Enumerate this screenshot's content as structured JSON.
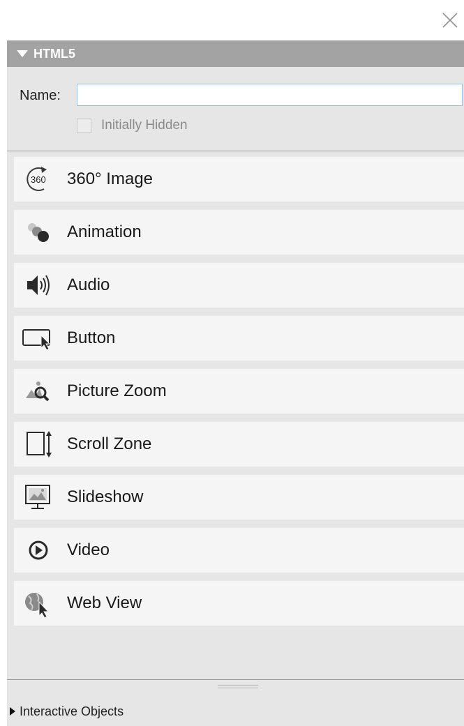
{
  "window": {
    "close_icon": "close-icon"
  },
  "section": {
    "title": "HTML5",
    "name_label": "Name:",
    "name_value": "",
    "initially_hidden_label": "Initially Hidden",
    "initially_hidden_checked": false
  },
  "items": [
    {
      "label": "360° Image",
      "icon": "360-image-icon"
    },
    {
      "label": "Animation",
      "icon": "animation-icon"
    },
    {
      "label": "Audio",
      "icon": "audio-icon"
    },
    {
      "label": "Button",
      "icon": "button-icon"
    },
    {
      "label": "Picture Zoom",
      "icon": "picture-zoom-icon"
    },
    {
      "label": "Scroll Zone",
      "icon": "scroll-zone-icon"
    },
    {
      "label": "Slideshow",
      "icon": "slideshow-icon"
    },
    {
      "label": "Video",
      "icon": "video-icon"
    },
    {
      "label": "Web View",
      "icon": "web-view-icon"
    }
  ],
  "footer": {
    "label": "Interactive Objects"
  },
  "colors": {
    "header": "#a3a3a3",
    "panel": "#e6e6e6",
    "item": "#f5f5f5",
    "input_border": "#9bbbd6"
  }
}
